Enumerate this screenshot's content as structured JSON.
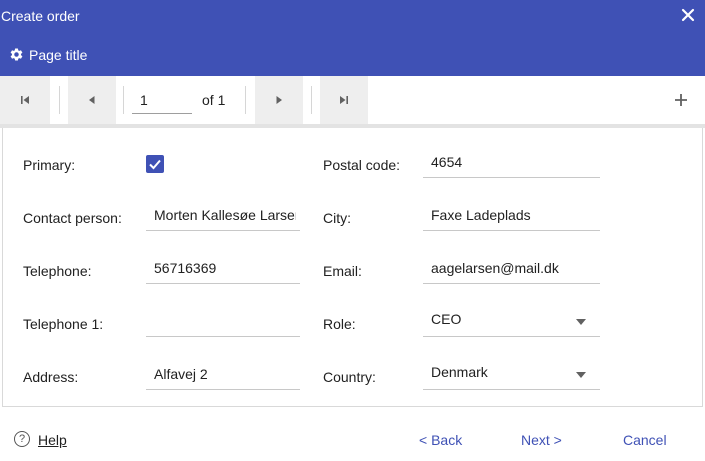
{
  "window": {
    "title": "Create order",
    "close_icon": "close-icon"
  },
  "page": {
    "title": "Page title",
    "icon": "gear-icon"
  },
  "pager": {
    "current_page": "1",
    "of_label": "of 1"
  },
  "form": {
    "primary_label": "Primary:",
    "primary_checked": true,
    "contact_label": "Contact person:",
    "contact_value": "Morten Kallesøe Larsen",
    "telephone_label": "Telephone:",
    "telephone_value": "56716369",
    "telephone1_label": "Telephone 1:",
    "telephone1_value": "",
    "address_label": "Address:",
    "address_value": "Alfavej 2",
    "postal_label": "Postal code:",
    "postal_value": "4654",
    "city_label": "City:",
    "city_value": "Faxe Ladeplads",
    "email_label": "Email:",
    "email_value": "aagelarsen@mail.dk",
    "role_label": "Role:",
    "role_value": "CEO",
    "country_label": "Country:",
    "country_value": "Denmark"
  },
  "footer": {
    "help_icon_glyph": "?",
    "help_label": "Help",
    "back_label": "<  Back",
    "next_label": "Next  >",
    "cancel_label": "Cancel"
  },
  "colors": {
    "primary": "#3f51b5",
    "toolbar_button": "#eeeeee"
  }
}
